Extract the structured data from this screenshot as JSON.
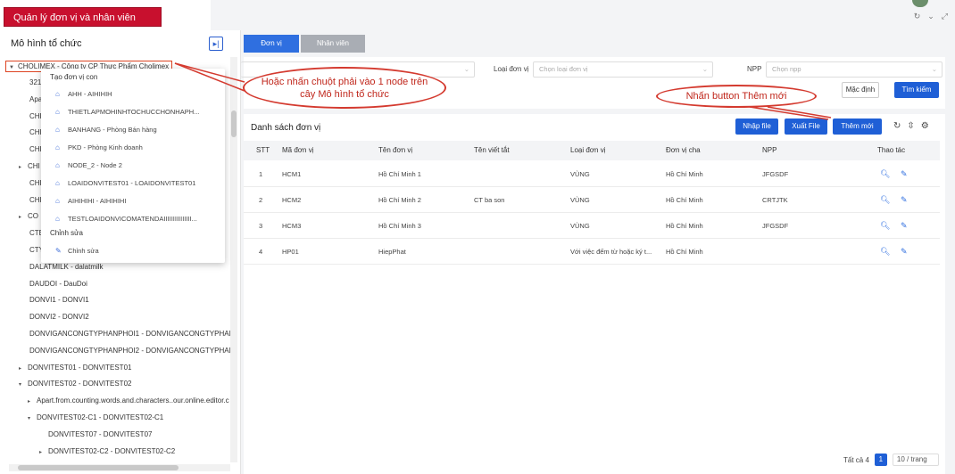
{
  "app": {
    "title": "Quản lý đơn vị và nhân viên"
  },
  "sidebar": {
    "title": "Mô hình tổ chức",
    "root": "CHOLIMEX - Công ty CP Thực Phẩm Cholimex",
    "nodes": [
      "321",
      "Apar",
      "CHI",
      "CHI",
      "CHI",
      "CHI",
      "CHI",
      "CHI",
      "CO",
      "CTE",
      "CTY",
      "DALATMILK - dalatmilk",
      "DAUDOI - DauDoi",
      "DONVI1 - DONVI1",
      "DONVI2 - DONVI2",
      "DONVIGANCONGTYPHANPHOI1 - DONVIGANCONGTYPHAN",
      "DONVIGANCONGTYPHANPHOI2 - DONVIGANCONGTYPHAN",
      "DONVITEST01 - DONVITEST01",
      "DONVITEST02 - DONVITEST02",
      "Apart.from.counting.words.and.characters..our.online.editor.c",
      "DONVITEST02-C1 - DONVITEST02-C1",
      "DONVITEST07 - DONVITEST07",
      "DONVITEST02-C2 - DONVITEST02-C2"
    ]
  },
  "context_menu": {
    "create_header": "Tạo đơn vị con",
    "items": [
      "AHH - AIHIHIH",
      "THIETLAPMOHINHTOCHUCCHONHAPH...",
      "BANHANG - Phòng Bán hàng",
      "PKD - Phòng Kinh doanh",
      "NODE_2 - Node 2",
      "LOAIDONVITEST01 - LOAIDONVITEST01",
      "AIHIHIHI - AIHIHIHI",
      "TESTLOAIDONVICOMATENDAIIIIIIIIIIIIIII..."
    ],
    "edit_header": "Chỉnh sửa",
    "edit_item": "Chỉnh sửa"
  },
  "tabs": [
    "Đơn vị",
    "Nhân viên"
  ],
  "filters": {
    "type_label": "Loại đơn vị",
    "type_placeholder": "Chọn loại đơn vị",
    "npp_label": "NPP",
    "npp_placeholder": "Chọn npp",
    "default_button": "Mặc định",
    "search_button": "Tìm kiếm"
  },
  "list": {
    "title": "Danh sách đơn vị",
    "import_button": "Nhập file",
    "export_button": "Xuất File",
    "add_button": "Thêm mới",
    "columns": [
      "STT",
      "Mã đơn vị",
      "Tên đơn vị",
      "Tên viết tắt",
      "Loại đơn vị",
      "Đơn vị cha",
      "NPP",
      "Thao tác"
    ],
    "rows": [
      [
        "1",
        "HCM1",
        "Hồ Chí Minh 1",
        "",
        "VÙNG",
        "Hồ Chí Minh",
        "JFGSDF"
      ],
      [
        "2",
        "HCM2",
        "Hồ Chí Minh 2",
        "CT ba son",
        "VÙNG",
        "Hồ Chí Minh",
        "CRTJTK"
      ],
      [
        "3",
        "HCM3",
        "Hồ Chí Minh 3",
        "",
        "VÙNG",
        "Hồ Chí Minh",
        "JFGSDF"
      ],
      [
        "4",
        "HP01",
        "HiepPhat",
        "",
        "Với việc đếm từ hoặc ký t...",
        "Hồ Chí Minh",
        ""
      ]
    ],
    "total": "Tất cả 4",
    "page": "1",
    "page_size": "10 / trang"
  },
  "callouts": {
    "right_click": "Hoặc nhấn chuột phải vào 1 node trên cây Mô hình tổ chức",
    "add_new": "Nhấn button Thêm mới"
  },
  "colors": {
    "brand_red": "#c8102e",
    "primary": "#1f5fd6",
    "annotation": "#d43a2f"
  }
}
